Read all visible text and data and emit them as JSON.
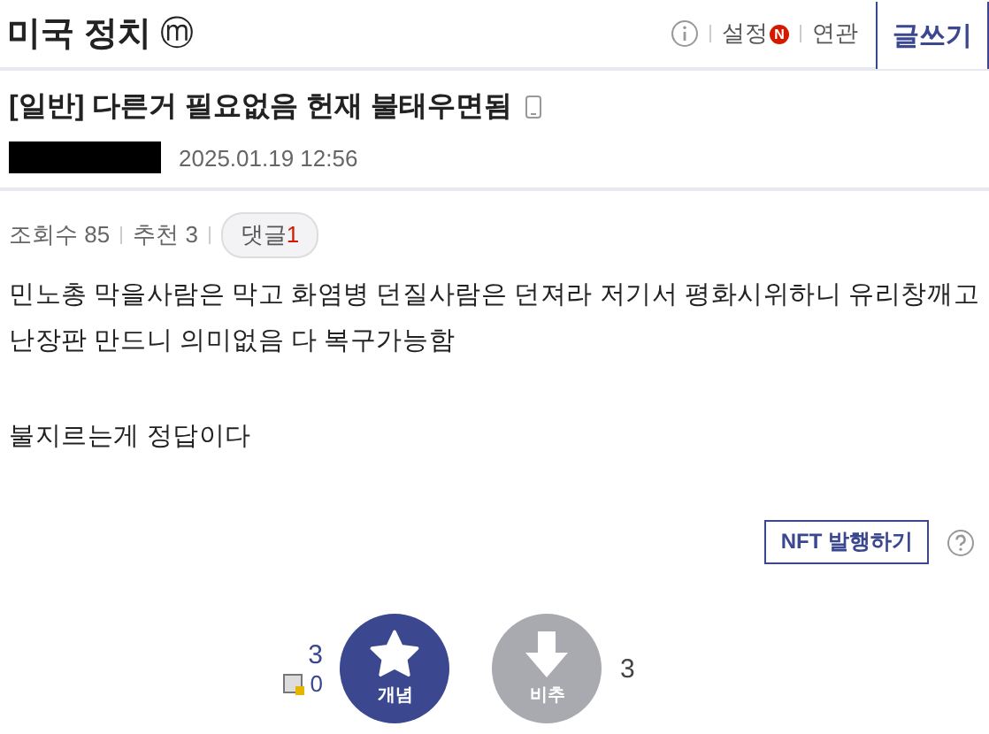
{
  "header": {
    "title": "미국 정치",
    "badge": "ⓜ",
    "links": [
      {
        "label": "설정",
        "new": true
      },
      {
        "label": "연관",
        "new": false
      }
    ],
    "new_mark": "N",
    "write_button": "글쓰기"
  },
  "post": {
    "title": "[일반] 다른거 필요없음 헌재 불태우면됨",
    "date": "2025.01.19 12:56",
    "stats": [
      {
        "label": "조회수 85"
      },
      {
        "label": "추천 3"
      }
    ],
    "comments": {
      "label": "댓글",
      "count": "1"
    },
    "body": [
      "민노총 막을사람은 막고 화염병 던질사람은 던져라 저기서 평화시위하니 유리창깨고 난장판 만드니 의미없음 다 복구가능함",
      "불지르는게 정답이다"
    ],
    "nft_button": "NFT 발행하기",
    "votes": {
      "up_count": "3",
      "up_fixed": "0",
      "up_label": "개념",
      "down_label": "비추",
      "down_count": "3"
    }
  }
}
